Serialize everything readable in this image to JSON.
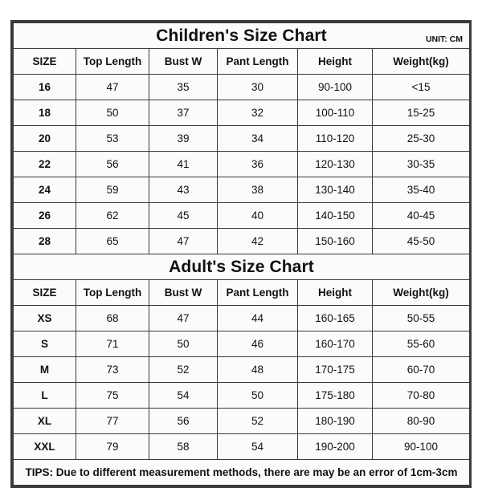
{
  "unit_label": "UNIT: CM",
  "columns": [
    "SIZE",
    "Top Length",
    "Bust W",
    "Pant Length",
    "Height",
    "Weight(kg)"
  ],
  "children": {
    "title": "Children's Size Chart",
    "rows": [
      [
        "16",
        "47",
        "35",
        "30",
        "90-100",
        "<15"
      ],
      [
        "18",
        "50",
        "37",
        "32",
        "100-110",
        "15-25"
      ],
      [
        "20",
        "53",
        "39",
        "34",
        "110-120",
        "25-30"
      ],
      [
        "22",
        "56",
        "41",
        "36",
        "120-130",
        "30-35"
      ],
      [
        "24",
        "59",
        "43",
        "38",
        "130-140",
        "35-40"
      ],
      [
        "26",
        "62",
        "45",
        "40",
        "140-150",
        "40-45"
      ],
      [
        "28",
        "65",
        "47",
        "42",
        "150-160",
        "45-50"
      ]
    ]
  },
  "adults": {
    "title": "Adult's Size Chart",
    "rows": [
      [
        "XS",
        "68",
        "47",
        "44",
        "160-165",
        "50-55"
      ],
      [
        "S",
        "71",
        "50",
        "46",
        "160-170",
        "55-60"
      ],
      [
        "M",
        "73",
        "52",
        "48",
        "170-175",
        "60-70"
      ],
      [
        "L",
        "75",
        "54",
        "50",
        "175-180",
        "70-80"
      ],
      [
        "XL",
        "77",
        "56",
        "52",
        "180-190",
        "80-90"
      ],
      [
        "XXL",
        "79",
        "58",
        "54",
        "190-200",
        "90-100"
      ]
    ]
  },
  "tips": "TIPS: Due to different measurement methods, there are may be an error of 1cm-3cm",
  "colors": {
    "header_blue": "#22ace4",
    "tips_red": "#e01b1b",
    "border": "#3a3a3a",
    "cell_bg": "#fbfbf9"
  }
}
